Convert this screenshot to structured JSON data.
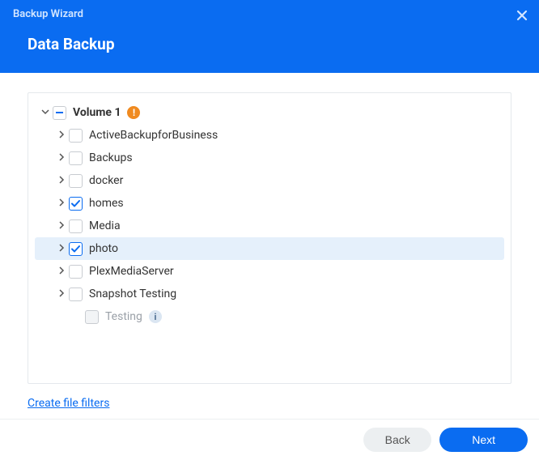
{
  "header": {
    "wizard_title": "Backup Wizard",
    "page_title": "Data Backup"
  },
  "tree": {
    "root": {
      "label": "Volume 1",
      "check_state": "partial",
      "expanded": true,
      "has_warning": true
    },
    "items": [
      {
        "label": "ActiveBackupforBusiness",
        "check_state": "unchecked",
        "expandable": true
      },
      {
        "label": "Backups",
        "check_state": "unchecked",
        "expandable": true
      },
      {
        "label": "docker",
        "check_state": "unchecked",
        "expandable": true
      },
      {
        "label": "homes",
        "check_state": "checked",
        "expandable": true
      },
      {
        "label": "Media",
        "check_state": "unchecked",
        "expandable": true
      },
      {
        "label": "photo",
        "check_state": "checked",
        "expandable": true,
        "selected": true
      },
      {
        "label": "PlexMediaServer",
        "check_state": "unchecked",
        "expandable": true
      },
      {
        "label": "Snapshot Testing",
        "check_state": "unchecked",
        "expandable": true
      }
    ],
    "disabled_item": {
      "label": "Testing",
      "check_state": "disabled",
      "has_info": true
    }
  },
  "links": {
    "create_filters": "Create file filters"
  },
  "footer": {
    "back": "Back",
    "next": "Next"
  }
}
